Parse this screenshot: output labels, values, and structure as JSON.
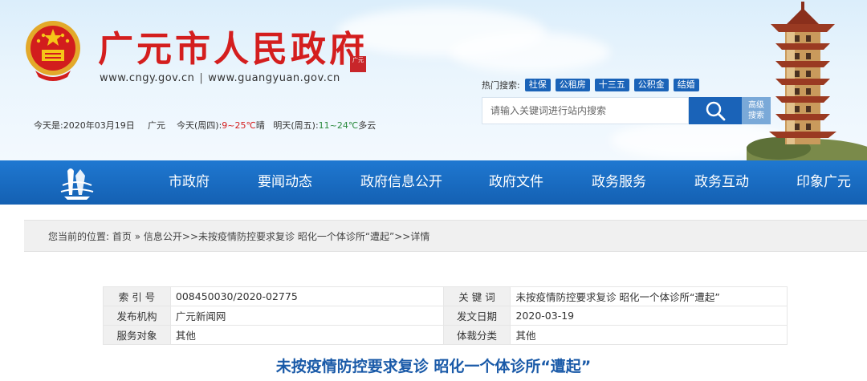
{
  "header": {
    "site_title": "广元市人民政府",
    "seal_text": "广元",
    "url_primary": "www.cngy.gov.cn",
    "url_separator": "|",
    "url_secondary": "www.guangyuan.gov.cn",
    "today": "今天是:2020年03月19日",
    "weather": {
      "city": "广元",
      "today_label": "今天(周四):",
      "today_temp": "9~25℃",
      "today_cond": "晴",
      "tomorrow_label": "明天(周五):",
      "tomorrow_temp": "11~24℃",
      "tomorrow_cond": "多云"
    },
    "hot_search_label": "热门搜索:",
    "hot_tags": [
      "社保",
      "公租房",
      "十三五",
      "公积金",
      "结婚"
    ],
    "search_placeholder": "请输入关键词进行站内搜索",
    "advanced_search_line1": "高级",
    "advanced_search_line2": "搜索",
    "icons": {
      "search": "search-icon",
      "emblem": "national-emblem-icon",
      "tower": "tower-landmark-icon"
    }
  },
  "nav": {
    "logo": "city-logo-icon",
    "items": [
      "市政府",
      "要闻动态",
      "政府信息公开",
      "政府文件",
      "政务服务",
      "政务互动",
      "印象广元"
    ]
  },
  "breadcrumb": {
    "prefix": "您当前的位置:",
    "home": "首页",
    "sep1": " » ",
    "section": "信息公开",
    "sep2": ">>",
    "article": "未按疫情防控要求复诊 昭化一个体诊所“遭起”",
    "sep3": ">>",
    "current": "详情"
  },
  "meta": {
    "index_no_label": "索 引 号",
    "index_no": "008450030/2020-02775",
    "keywords_label": "关 键 词",
    "keywords": "未按疫情防控要求复诊 昭化一个体诊所“遭起”",
    "publisher_label": "发布机构",
    "publisher": "广元新闻网",
    "date_label": "发文日期",
    "date": "2020-03-19",
    "audience_label": "服务对象",
    "audience": "其他",
    "genre_label": "体裁分类",
    "genre": "其他"
  },
  "article": {
    "title": "未按疫情防控要求复诊 昭化一个体诊所“遭起”"
  },
  "colors": {
    "brand_red": "#d41e1e",
    "nav_blue": "#1a63b8",
    "title_blue": "#1a5aa8"
  }
}
